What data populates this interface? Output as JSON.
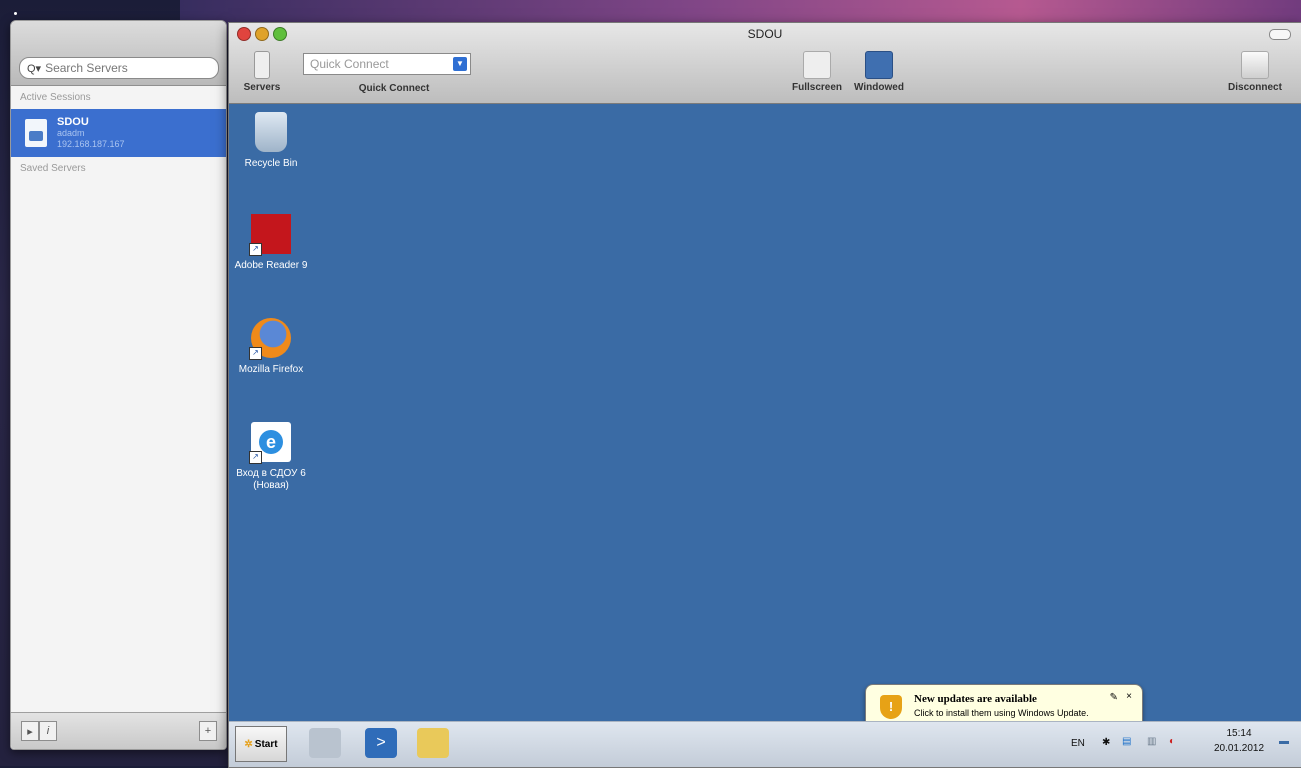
{
  "server_list": {
    "search_placeholder": "Search Servers",
    "active_sessions_label": "Active Sessions",
    "saved_servers_label": "Saved Servers",
    "active_sessions": [
      {
        "name": "SDOU",
        "user": "adadm",
        "host": "192.168.187.167"
      }
    ]
  },
  "window": {
    "title": "SDOU",
    "toolbar": {
      "servers_label": "Servers",
      "quick_connect_label": "Quick Connect",
      "quick_connect_placeholder": "Quick Connect",
      "fullscreen_label": "Fullscreen",
      "windowed_label": "Windowed",
      "disconnect_label": "Disconnect"
    }
  },
  "desktop": {
    "icons": [
      {
        "label": "Recycle Bin",
        "icon": "recycle-bin-icon"
      },
      {
        "label": "Adobe Reader 9",
        "icon": "adobe-reader-icon"
      },
      {
        "label": "Mozilla Firefox",
        "icon": "firefox-icon"
      },
      {
        "label": "Вход в СДОУ 6 (Новая)",
        "icon": "internet-explorer-icon"
      }
    ],
    "notification": {
      "title": "New updates are available",
      "body": "Click to install them using Windows Update."
    },
    "taskbar": {
      "start_label": "Start",
      "language": "EN",
      "time": "15:14",
      "date": "20.01.2012"
    }
  },
  "colors": {
    "desktop": "#3a6ba5",
    "selection": "#3b6fcf",
    "notification_bg": "#ffffe1"
  }
}
